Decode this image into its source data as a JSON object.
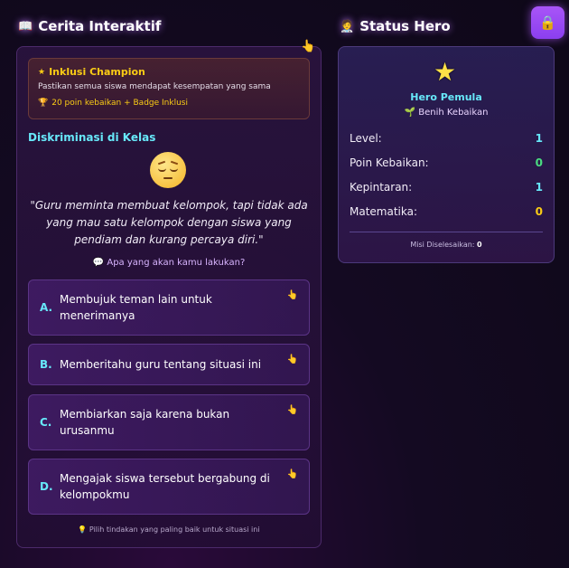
{
  "left_panel": {
    "title": "Cerita Interaktif",
    "title_icon": "book-icon"
  },
  "right_panel": {
    "title": "Status Hero",
    "title_icon": "hero-icon"
  },
  "lock_button": {
    "icon": "lock-icon"
  },
  "mission": {
    "title": "Inklusi Champion",
    "description": "Pastikan semua siswa mendapat kesempatan yang sama",
    "reward": "20 poin kebaikan + Badge Inklusi"
  },
  "scene": {
    "title": "Diskriminasi di Kelas",
    "emoji": "pensive-face-icon",
    "quote": "\"Guru meminta membuat kelompok, tapi tidak ada yang mau satu kelompok dengan siswa yang pendiam dan kurang percaya diri.\"",
    "prompt": "Apa yang akan kamu lakukan?"
  },
  "choices": [
    {
      "letter": "A.",
      "text": "Membujuk teman lain untuk menerimanya"
    },
    {
      "letter": "B.",
      "text": "Memberitahu guru tentang situasi ini"
    },
    {
      "letter": "C.",
      "text": "Membiarkan saja karena bukan urusanmu"
    },
    {
      "letter": "D.",
      "text": "Mengajak siswa tersebut bergabung di kelompokmu"
    }
  ],
  "hint": "Pilih tindakan yang paling baik untuk situasi ini",
  "hero": {
    "rank": "Hero Pemula",
    "subtitle": "Benih Kebaikan",
    "stats": {
      "level_label": "Level:",
      "level_value": "1",
      "poin_label": "Poin Kebaikan:",
      "poin_value": "0",
      "kepintaran_label": "Kepintaran:",
      "kepintaran_value": "1",
      "matematika_label": "Matematika:",
      "matematika_value": "0"
    },
    "missions_label": "Misi Diselesaikan:",
    "missions_value": "0"
  },
  "colors": {
    "accent": "#a855f7",
    "cyan": "#67e8f9",
    "gold": "#facc15",
    "green": "#4ade80"
  }
}
